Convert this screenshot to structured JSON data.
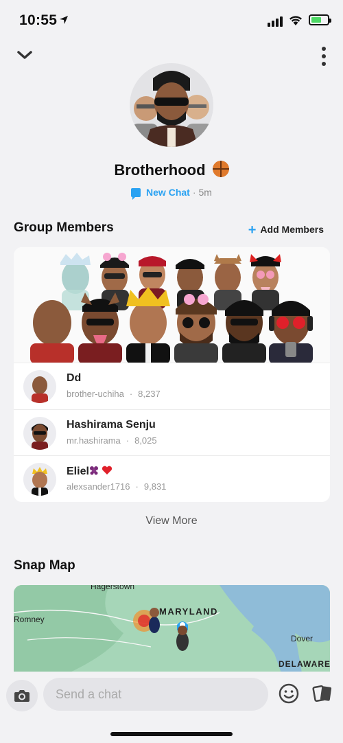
{
  "status_bar": {
    "time": "10:55"
  },
  "header": {
    "group_name": "Brotherhood",
    "chat_link": "New Chat",
    "separator": "·",
    "last_active": "5m"
  },
  "group_members": {
    "title": "Group Members",
    "add_label": "Add Members",
    "members": [
      {
        "name": "Dd",
        "username": "brother-uchiha",
        "score": "8,237"
      },
      {
        "name": "Hashirama Senju",
        "username": "mr.hashirama",
        "score": "8,025"
      },
      {
        "name": "Eliel",
        "username": "alexsander1716",
        "score": "9,831"
      }
    ],
    "view_more": "View More"
  },
  "snap_map": {
    "title": "Snap Map",
    "labels": {
      "hagerstown": "Hagerstown",
      "maryland": "MARYLAND",
      "romney": "Romney",
      "dover": "Dover",
      "delaware": "DELAWARE"
    }
  },
  "composer": {
    "placeholder": "Send a chat"
  },
  "colors": {
    "accent": "#2aa2f2",
    "background": "#f2f2f4",
    "card": "#ffffff"
  }
}
